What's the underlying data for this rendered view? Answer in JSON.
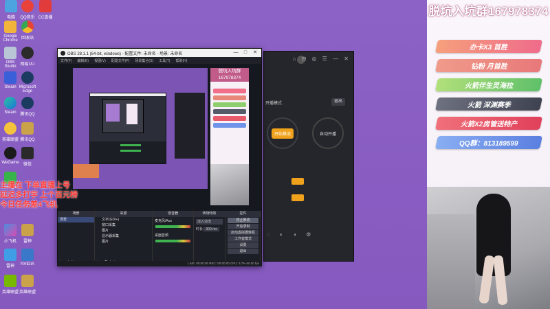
{
  "desktop": {
    "icons": [
      {
        "label": "电脑",
        "x": 1
      },
      {
        "label": "QQ音乐",
        "x": 2
      },
      {
        "label": "CC直播",
        "x": 3
      },
      {
        "label": "Google Chrome",
        "x": 4
      },
      {
        "label": "回收站",
        "x": 5
      },
      {
        "label": "OBS Studio",
        "x": 6
      },
      {
        "label": "网易UU",
        "x": 7
      },
      {
        "label": "Steam",
        "x": 8
      },
      {
        "label": "Microsoft Edge",
        "x": 9
      },
      {
        "label": "Steam",
        "x": 10
      },
      {
        "label": "腾讯QQ",
        "x": 11
      },
      {
        "label": "英雄联盟",
        "x": 12
      },
      {
        "label": "腾讯QQ",
        "x": 13
      },
      {
        "label": "WeGame",
        "x": 14
      },
      {
        "label": "微信",
        "x": 15
      },
      {
        "label": "Google",
        "x": 16
      },
      {
        "label": "英雄联盟",
        "x": 17
      },
      {
        "label": "小飞机",
        "x": 18
      },
      {
        "label": "雷神",
        "x": 19
      },
      {
        "label": "NVIDIA",
        "x": 20
      },
      {
        "label": "英雄联盟",
        "x": 21
      }
    ]
  },
  "side": {
    "title": "脱坑入坑群167978374",
    "pills": [
      {
        "label": "办卡X3 首胜",
        "color": "#f0708a"
      },
      {
        "label": "钻粉 月首胜",
        "color": "#e8887a"
      },
      {
        "label": "火箭伴生灵海拉",
        "color": "#8fce6d"
      },
      {
        "label": "火箭 深渊赛季",
        "color": "#555a68"
      },
      {
        "label": "火箭X2房管送特产",
        "color": "#e85a6b"
      },
      {
        "label": "QQ群：813189599",
        "color": "#6e93e8"
      }
    ]
  },
  "obs": {
    "title": "OBS 28.1.1 (64-bit, windows) - 配置文件: 未命名 - 场景: 未命名",
    "menu": [
      "文件(F)",
      "编辑(E)",
      "视图(V)",
      "配置文件(P)",
      "场景集合(S)",
      "工具(T)",
      "帮助(H)"
    ],
    "preview_group": "脱坑入坑群167978374",
    "dock_titles": [
      "场景",
      "来源",
      "混音器",
      "转场特效",
      "控件"
    ],
    "scenes": [
      "场景"
    ],
    "sources": [
      "文字(GDI+)",
      "窗口采集",
      "图片",
      "显示器采集",
      "图片"
    ],
    "mixer": [
      {
        "name": "麦克风/Aux",
        "level": "0.0 dB"
      },
      {
        "name": "桌面音频",
        "level": "0.0 dB"
      }
    ],
    "transition": {
      "type": "淡入淡出",
      "duration_label": "时长",
      "duration": "300 ms"
    },
    "controls": [
      "停止推流",
      "开始录制",
      "启动虚拟摄像机",
      "工作室模式",
      "设置",
      "退出"
    ],
    "statusbar": "LIVE: 00:00:00  REC: 00:00:00  CPU: 3.7%  60.00 fps"
  },
  "app2": {
    "close_label": "退出",
    "mode_a": "开始推流",
    "mode_b": "自动开播",
    "subtitle": "开播模式"
  },
  "caption": {
    "lines": [
      "主播在 下单直播上号",
      "延迟多打字  上个百元榜",
      "今日任务差4飞机"
    ]
  }
}
